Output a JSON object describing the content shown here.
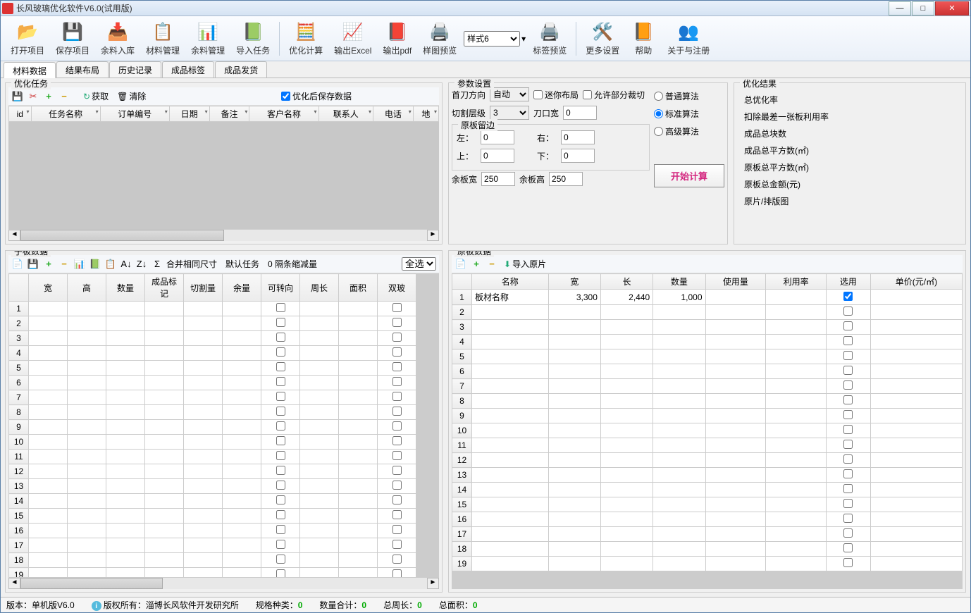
{
  "title": "长风玻璃优化软件V6.0(试用版)",
  "toolbar": [
    {
      "icon": "📂",
      "label": "打开项目",
      "name": "open-project-button"
    },
    {
      "icon": "💾",
      "label": "保存项目",
      "name": "save-project-button"
    },
    {
      "icon": "📥",
      "label": "余料入库",
      "name": "scrap-in-button"
    },
    {
      "icon": "📋",
      "label": "材料管理",
      "name": "material-manage-button"
    },
    {
      "icon": "📊",
      "label": "余料管理",
      "name": "scrap-manage-button"
    },
    {
      "icon": "📗",
      "label": "导入任务",
      "name": "import-task-button"
    },
    {
      "sep": true
    },
    {
      "icon": "🧮",
      "label": "优化计算",
      "name": "optimize-button"
    },
    {
      "icon": "📈",
      "label": "输出Excel",
      "name": "export-excel-button"
    },
    {
      "icon": "📕",
      "label": "输出pdf",
      "name": "export-pdf-button"
    },
    {
      "icon": "🖨️",
      "label": "样图预览",
      "name": "preview-sample-button"
    },
    {
      "style_select": true,
      "value": "样式6"
    },
    {
      "icon": "🖨️",
      "label": "标签预览",
      "name": "preview-label-button"
    },
    {
      "sep": true
    },
    {
      "icon": "🛠️",
      "label": "更多设置",
      "name": "more-settings-button"
    },
    {
      "icon": "📙",
      "label": "帮助",
      "name": "help-button"
    },
    {
      "icon": "👥",
      "label": "关于与注册",
      "name": "about-button"
    }
  ],
  "tabs": [
    "材料数据",
    "结果布局",
    "历史记录",
    "成品标签",
    "成品发货"
  ],
  "active_tab": 0,
  "task_panel": {
    "title": "优化任务",
    "toolbar": {
      "fetch": "获取",
      "clear": "清除",
      "checkbox_label": "优化后保存数据",
      "checkbox_checked": true
    },
    "columns": [
      "id",
      "任务名称",
      "订单编号",
      "日期",
      "备注",
      "客户名称",
      "联系人",
      "电话",
      "地"
    ]
  },
  "params": {
    "title": "参数设置",
    "first_cut_label": "首刀方向",
    "first_cut_value": "自动",
    "mini_layout_label": "迷你布局",
    "mini_layout_checked": false,
    "allow_partial_label": "允许部分裁切",
    "allow_partial_checked": false,
    "cut_levels_label": "切割层级",
    "cut_levels_value": "3",
    "kerf_label": "刀口宽",
    "kerf_value": "0",
    "margin_title": "原板留边",
    "left_label": "左：",
    "left_value": "0",
    "right_label": "右：",
    "right_value": "0",
    "top_label": "上：",
    "top_value": "0",
    "bottom_label": "下：",
    "bottom_value": "0",
    "scrap_w_label": "余板宽",
    "scrap_w_value": "250",
    "scrap_h_label": "余板高",
    "scrap_h_value": "250",
    "algo_normal": "普通算法",
    "algo_standard": "标准算法",
    "algo_advanced": "高级算法",
    "algo_selected": "standard",
    "calc_button": "开始计算"
  },
  "results": {
    "title": "优化结果",
    "lines": [
      "总优化率",
      "扣除最差一张板利用率",
      "成品总块数",
      "成品总平方数(㎡)",
      "原板总平方数(㎡)",
      "原板总金额(元)",
      "原片/排版图"
    ]
  },
  "sub_panel": {
    "title": "子板数据",
    "toolbar": {
      "merge_label": "合并相同尺寸",
      "default_task_label": "默认任务",
      "reduce_label": "0 隔条缩减量",
      "select_all": "全选"
    },
    "columns": [
      "宽",
      "高",
      "数量",
      "成品标记",
      "切割量",
      "余量",
      "可转向",
      "周长",
      "面积",
      "双玻"
    ],
    "rows": 20
  },
  "orig_panel": {
    "title": "原板数据",
    "toolbar": {
      "import_label": "导入原片"
    },
    "columns": [
      "名称",
      "宽",
      "长",
      "数量",
      "使用量",
      "利用率",
      "选用",
      "单价(元/㎡)"
    ],
    "rows": 19,
    "data_row": {
      "name": "板材名称",
      "width": "3,300",
      "length": "2,440",
      "qty": "1,000",
      "selected": true
    }
  },
  "status": {
    "version_label": "版本：单机版V6.0",
    "copyright": "版权所有：淄博长风软件开发研究所",
    "spec_label": "规格种类：",
    "spec_val": "0",
    "qty_label": "数量合计：",
    "qty_val": "0",
    "perim_label": "总周长：",
    "perim_val": "0",
    "area_label": "总面积：",
    "area_val": "0"
  }
}
